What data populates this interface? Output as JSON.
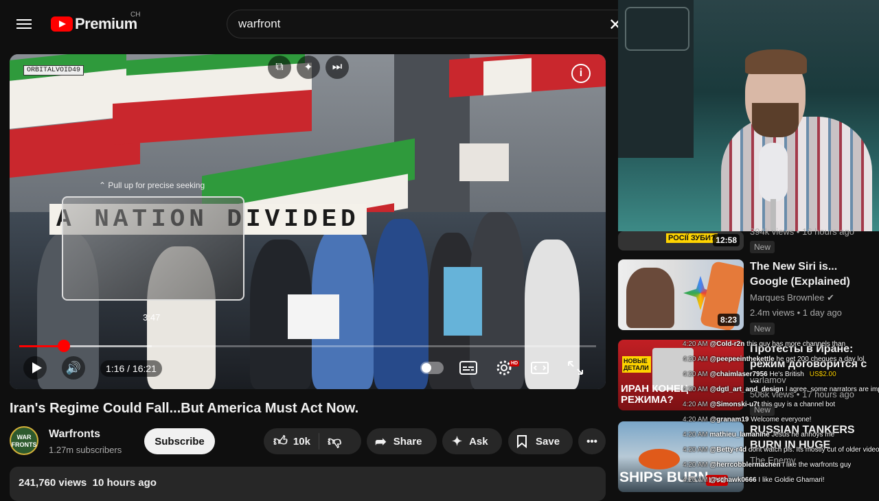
{
  "header": {
    "logo_word": "Premium",
    "country": "CH",
    "search_value": "warfront",
    "clear_label": "✕"
  },
  "player": {
    "channel_tag": "ORBITALVOID49",
    "banner_text": "A NATION DIVIDED",
    "seek_hint": "⌃ Pull up for precise seeking",
    "preview_time": "3:47",
    "time_display": "1:16 / 16:21",
    "progress_fraction": 0.077,
    "buffered_fraction": 0.23,
    "hd_badge": "HD"
  },
  "video": {
    "title": "Iran's Regime Could Fall...But America Must Act Now.",
    "channel_name": "Warfronts",
    "channel_avatar_text": "WAR FRONTS",
    "subscribers": "1.27m subscribers",
    "subscribe_label": "Subscribe",
    "likes": "10k",
    "share_label": "Share",
    "ask_label": "Ask",
    "save_label": "Save",
    "views": "241,760 views",
    "posted": "10 hours ago"
  },
  "recommendations": [
    {
      "thumb_text": "РОСІЇ ЗУБИ?",
      "duration": "12:58",
      "meta_partial": "394k views • 16 hours ago",
      "badge": "New"
    },
    {
      "title": "The New Siri is... Google (Explained)",
      "channel": "Marques Brownlee",
      "meta": "2.4m views • 1 day ago",
      "duration": "8:23",
      "badge": "New"
    },
    {
      "title": "Протесты в Иране: режим договорится с ...",
      "thumb_top": "НОВЫЕ ДЕТАЛИ",
      "thumb_bottom": "ИРАН КОНЕЦ РЕЖИМА?",
      "channel": "varlamov",
      "meta": "506k views • 17 hours ago",
      "badge": "New"
    },
    {
      "title": "RUSSIAN TANKERS BURN IN HUGE ATTACK, US PREPAR...",
      "thumb_text": "SHIPS BURN",
      "channel": "The Enemy",
      "live": "LIVE"
    }
  ],
  "chat": [
    {
      "time": "4:20 AM",
      "user": "@Cold-r2n",
      "msg": "this guy has more channels than"
    },
    {
      "time": "4:20 AM",
      "user": "@peepeeinthekettle",
      "msg": "he get 200 cheques a day lol"
    },
    {
      "time": "4:20 AM",
      "user": "@chaimlaser7956",
      "msg": "He's British",
      "amount": "US$2.00"
    },
    {
      "time": "4:20 AM",
      "user": "@dgtl_art_and_design",
      "msg": "I agree, some narrators are impossible to listen to,"
    },
    {
      "time": "4:20 AM",
      "user": "@Simonski-u7t",
      "msg": "this guy is a channel bot"
    },
    {
      "time": "4:20 AM",
      "user": "@granam19",
      "msg": "Welcome everyone!"
    },
    {
      "time": "4:20 AM",
      "user": "mathieu_lamanine",
      "msg": "Jesus he annoys me"
    },
    {
      "time": "4:20 AM",
      "user": "@Betty-r4d",
      "msg": "dont watch pls. Its mostly cut of older videos i guess"
    },
    {
      "time": "4:20 AM",
      "user": "@herrcobblermachen",
      "msg": "I like the warfronts guy"
    },
    {
      "time": "4:20 AM",
      "user": "@schawk0666",
      "msg": "I like Goldie Ghamari!"
    }
  ],
  "colors": {
    "accent_red": "#ff0000",
    "background": "#0f0f0f",
    "pill": "#272727"
  }
}
